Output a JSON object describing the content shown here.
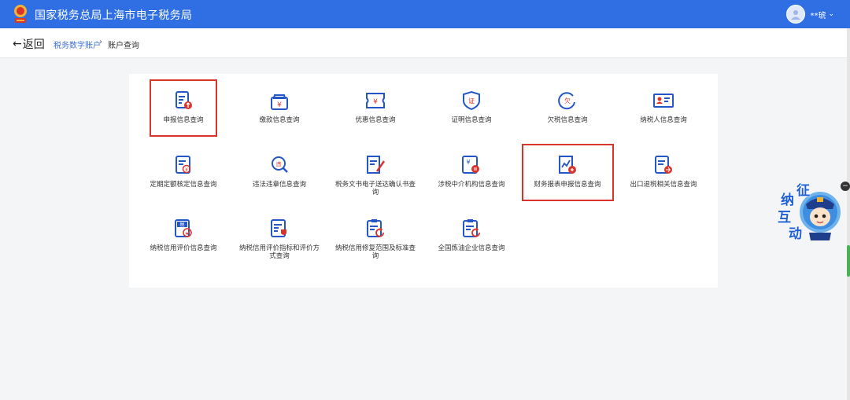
{
  "header": {
    "title": "国家税务总局上海市电子税务局",
    "username": "**琥",
    "colors": {
      "header_bg": "#2f6fe3",
      "accent": "#3b6fd8",
      "highlight": "#d9342b"
    }
  },
  "breadcrumb": {
    "back_label": "返回",
    "back_arrow": "←",
    "parent": "税务数字账户",
    "separator": "›",
    "current": "账户查询"
  },
  "items": [
    {
      "label": "申报信息查询",
      "icon": "declaration-doc-icon"
    },
    {
      "label": "缴款信息查询",
      "icon": "payment-wallet-icon"
    },
    {
      "label": "优惠信息查询",
      "icon": "discount-ticket-icon"
    },
    {
      "label": "证明信息查询",
      "icon": "certificate-shield-icon"
    },
    {
      "label": "欠税信息查询",
      "icon": "tax-arrears-icon"
    },
    {
      "label": "纳税人信息查询",
      "icon": "taxpayer-card-icon"
    },
    {
      "label": "定期定额核定信息查询",
      "icon": "fixed-quota-doc-icon"
    },
    {
      "label": "违法违章信息查询",
      "icon": "violation-search-icon"
    },
    {
      "label": "税务文书电子送达确认书查询",
      "icon": "document-edit-icon"
    },
    {
      "label": "涉税中介机构信息查询",
      "icon": "tax-agency-icon"
    },
    {
      "label": "财务报表申报信息查询",
      "icon": "financial-report-icon"
    },
    {
      "label": "出口退税相关信息查询",
      "icon": "export-refund-icon"
    },
    {
      "label": "纳税信用评价信息查询",
      "icon": "credit-rating-icon"
    },
    {
      "label": "纳税信用评价指标和评价方式查询",
      "icon": "credit-index-icon"
    },
    {
      "label": "纳税信用修复范围及标准查询",
      "icon": "credit-repair-icon"
    },
    {
      "label": "全国炼油企业信息查询",
      "icon": "refinery-enterprise-icon"
    }
  ],
  "highlighted": [
    "申报信息查询",
    "财务报表申报信息查询"
  ],
  "widget": {
    "chars": [
      "征",
      "纳",
      "互",
      "动"
    ]
  },
  "side_button": "−"
}
